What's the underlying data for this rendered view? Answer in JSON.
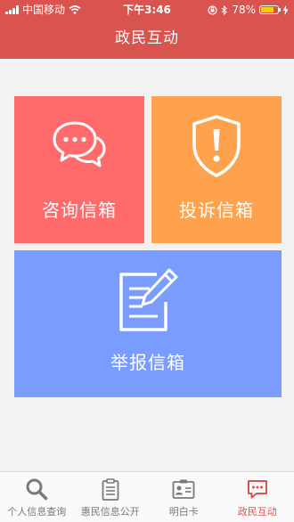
{
  "status_bar": {
    "carrier": "中国移动",
    "time": "下午3:46",
    "battery_percent": "78%",
    "battery_level": 0.78,
    "icons": [
      "signal-icon",
      "wifi-icon",
      "lock-rotation-icon",
      "bluetooth-icon",
      "battery-icon",
      "charging-icon"
    ]
  },
  "header": {
    "title": "政民互动"
  },
  "tiles": [
    {
      "label": "咨询信箱",
      "color": "#ff6b6b",
      "icon": "chat-bubbles-icon"
    },
    {
      "label": "投诉信箱",
      "color": "#ffa24d",
      "icon": "shield-alert-icon"
    },
    {
      "label": "举报信箱",
      "color": "#7b9cff",
      "icon": "edit-document-icon"
    }
  ],
  "tabbar": {
    "items": [
      {
        "label": "个人信息查询",
        "icon": "search-icon",
        "active": false
      },
      {
        "label": "惠民信息公开",
        "icon": "clipboard-icon",
        "active": false
      },
      {
        "label": "明白卡",
        "icon": "id-card-icon",
        "active": false
      },
      {
        "label": "政民互动",
        "icon": "message-icon",
        "active": true
      }
    ]
  },
  "colors": {
    "header_bg": "#d9534f",
    "page_bg": "#f2f2f2",
    "tab_active": "#d9534f",
    "tab_inactive": "#7a7a7a"
  }
}
